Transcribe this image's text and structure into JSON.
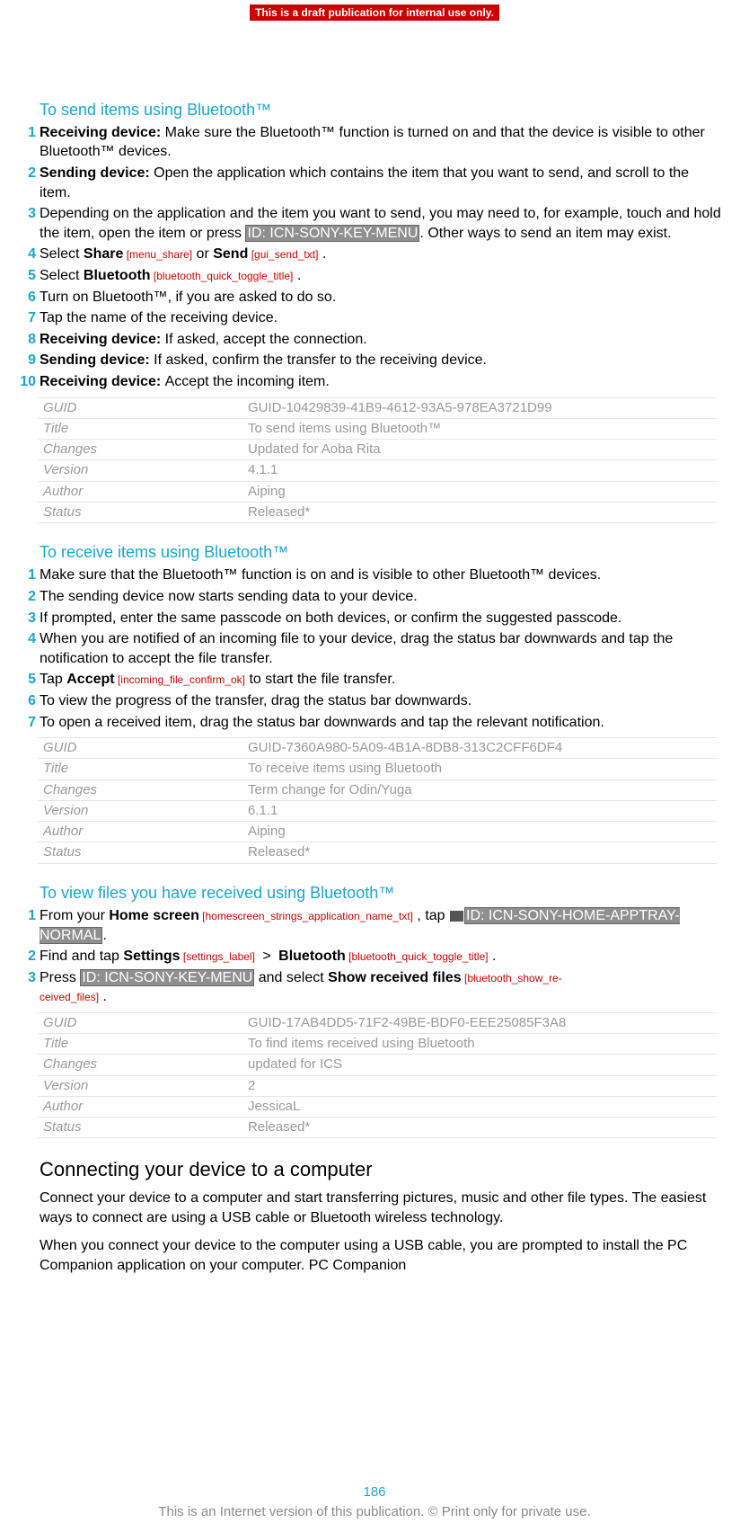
{
  "banner": "This is a draft publication for internal use only.",
  "sections": {
    "send": {
      "heading": "To send items using Bluetooth™",
      "steps": [
        {
          "prefix": "Receiving device: ",
          "text": "Make sure the Bluetooth™ function is turned on and that the device is visible to other Bluetooth™ devices."
        },
        {
          "prefix": "Sending device: ",
          "text": "Open the application which contains the item that you want to send, and scroll to the item."
        },
        {
          "text_a": "Depending on the application and the item you want to send, you may need to, for example, touch and hold the item, open the item or press ",
          "hl1": "ID: ICN-SONY-KEY-MENU",
          "text_b": ". Other ways to send an item may exist."
        },
        {
          "text_a": "Select ",
          "b1": "Share",
          "ref1": " [menu_share]",
          "text_b": " or ",
          "b2": "Send",
          "ref2": " [gui_send_txt]",
          "text_c": " ."
        },
        {
          "text_a": "Select ",
          "b1": "Bluetooth",
          "ref1": " [bluetooth_quick_toggle_title]",
          "text_b": " ."
        },
        {
          "text": "Turn on Bluetooth™, if you are asked to do so."
        },
        {
          "text": "Tap the name of the receiving device."
        },
        {
          "prefix": "Receiving device: ",
          "text": "If asked, accept the connection."
        },
        {
          "prefix": "Sending device: ",
          "text": "If asked, confirm the transfer to the receiving device."
        },
        {
          "prefix": "Receiving device: ",
          "text": "Accept the incoming item."
        }
      ],
      "meta": {
        "GUID": "GUID-10429839-41B9-4612-93A5-978EA3721D99",
        "Title": "To send items using Bluetooth™",
        "Changes": "Updated for Aoba Rita",
        "Version": "4.1.1",
        "Author": "Aiping",
        "Status": "Released*"
      }
    },
    "receive": {
      "heading": "To receive items using Bluetooth™",
      "steps": [
        {
          "text": "Make sure that the Bluetooth™ function is on and is visible to other Bluetooth™ devices."
        },
        {
          "text": "The sending device now starts sending data to your device."
        },
        {
          "text": "If prompted, enter the same passcode on both devices, or confirm the suggested passcode."
        },
        {
          "text": "When you are notified of an incoming file to your device, drag the status bar downwards and tap the notification to accept the file transfer."
        },
        {
          "text_a": "Tap ",
          "b1": "Accept",
          "ref1": " [incoming_file_confirm_ok]",
          "text_b": " to start the file transfer."
        },
        {
          "text": "To view the progress of the transfer, drag the status bar downwards."
        },
        {
          "text": "To open a received item, drag the status bar downwards and tap the relevant notification."
        }
      ],
      "meta": {
        "GUID": "GUID-7360A980-5A09-4B1A-8DB8-313C2CFF6DF4",
        "Title": "To receive items using Bluetooth",
        "Changes": "Term change for Odin/Yuga",
        "Version": "6.1.1",
        "Author": "Aiping",
        "Status": "Released*"
      }
    },
    "view": {
      "heading": "To view files you have received using Bluetooth™",
      "steps": [
        {
          "text_a": "From your ",
          "b1": "Home screen",
          "ref1": " [homescreen_strings_application_name_txt]",
          "text_b": " , tap ",
          "hl1": "ID: ICN-SONY-HOME-APPTRAY-NORMAL",
          "text_c": "."
        },
        {
          "text_a": "Find and tap ",
          "b1": "Settings",
          "ref1": " [settings_label]",
          "gt": " > ",
          "b2": "Bluetooth",
          "ref2": " [bluetooth_quick_toggle_title]",
          "text_b": " ."
        },
        {
          "text_a": "Press ",
          "hl1": "ID: ICN-SONY-KEY-MENU",
          "text_b": " and select ",
          "b1": "Show received files",
          "ref1": " [bluetooth_show_re-",
          "ref2": "ceived_files]",
          "text_c": " ."
        }
      ],
      "meta": {
        "GUID": "GUID-17AB4DD5-71F2-49BE-BDF0-EEE25085F3A8",
        "Title": "To find items received using Bluetooth",
        "Changes": "updated for ICS",
        "Version": "2",
        "Author": "JessicaL",
        "Status": "Released*"
      }
    },
    "connect": {
      "heading": "Connecting your device to a computer",
      "para1": "Connect your device to a computer and start transferring pictures, music and other file types. The easiest ways to connect are using a USB cable or Bluetooth wireless technology.",
      "para2": "When you connect your device to the computer using a USB cable, you are prompted to install the PC Companion application on your computer. PC Companion"
    }
  },
  "meta_labels": {
    "GUID": "GUID",
    "Title": "Title",
    "Changes": "Changes",
    "Version": "Version",
    "Author": "Author",
    "Status": "Status"
  },
  "footer": {
    "page": "186",
    "text": "This is an Internet version of this publication. © Print only for private use."
  }
}
